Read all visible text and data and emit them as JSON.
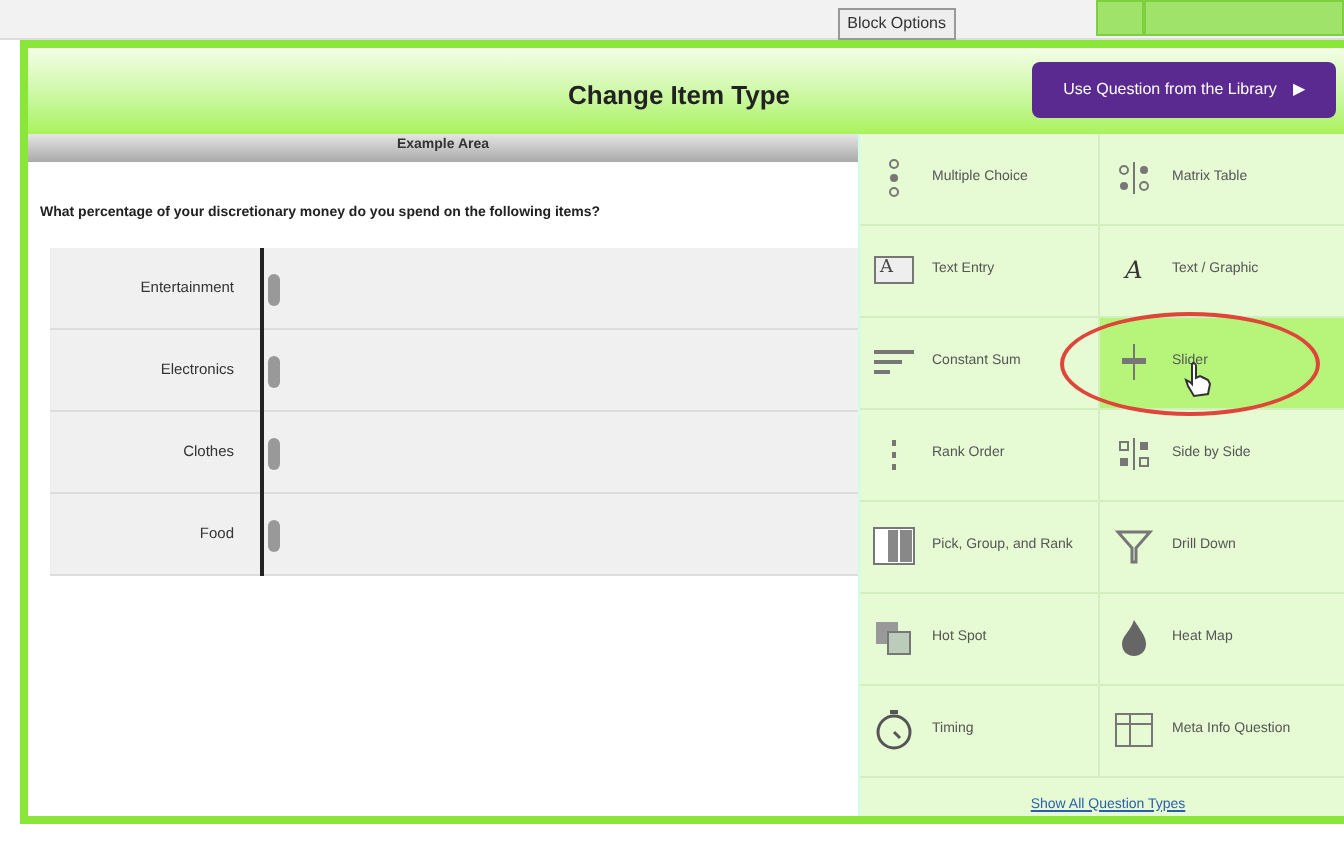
{
  "background": {
    "block_options": "Block Options"
  },
  "dialog": {
    "title": "Change Item Type",
    "library_button": "Use Question from the Library",
    "library_arrow": "▶",
    "example_area": {
      "title": "Example Area",
      "question": "What percentage of your discretionary money do you spend on the following items?",
      "sliders": [
        {
          "label": "Entertainment",
          "level": 0
        },
        {
          "label": "Electronics",
          "level": 0
        },
        {
          "label": "Clothes",
          "level": 0
        },
        {
          "label": "Food",
          "level": 0
        }
      ]
    },
    "question_types": [
      {
        "label": "Multiple Choice",
        "selected": false
      },
      {
        "label": "Matrix Table",
        "selected": false
      },
      {
        "label": "Text Entry",
        "selected": false,
        "icon_letter": "A"
      },
      {
        "label": "Text / Graphic",
        "selected": false,
        "icon_letter": "A"
      },
      {
        "label": "Constant Sum",
        "selected": false
      },
      {
        "label": "Slider",
        "selected": true
      },
      {
        "label": "Rank Order",
        "selected": false
      },
      {
        "label": "Side by Side",
        "selected": false
      },
      {
        "label": "Pick, Group, and Rank",
        "selected": false
      },
      {
        "label": "Drill Down",
        "selected": false
      },
      {
        "label": "Hot Spot",
        "selected": false
      },
      {
        "label": "Heat Map",
        "selected": false
      },
      {
        "label": "Timing",
        "selected": false
      },
      {
        "label": "Meta Info Question",
        "selected": false
      }
    ],
    "show_all_link": "Show All Question Types"
  }
}
